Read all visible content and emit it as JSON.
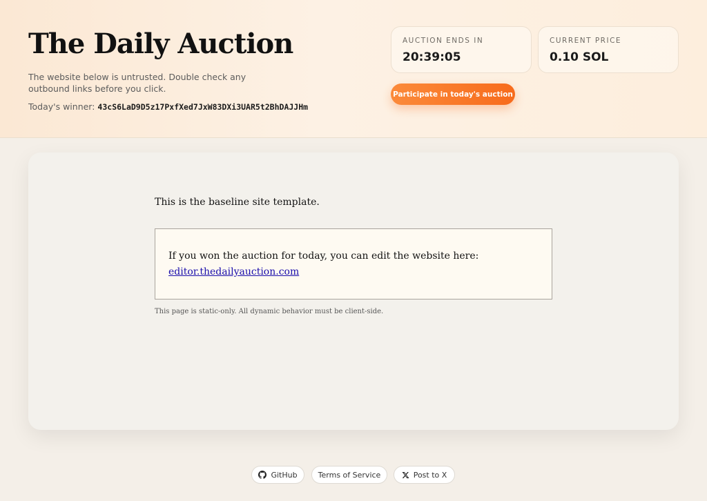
{
  "header": {
    "title": "The Daily Auction",
    "notice": "The website below is untrusted. Double check any outbound links before you click.",
    "winner_label": "Today's winner:",
    "winner_address": "43cS6LaD9D5z17PxfXed7JxW83DXi3UAR5t2BhDAJJHm"
  },
  "auction": {
    "ends_label": "AUCTION ENDS IN",
    "ends_value": "20:39:05",
    "price_label": "CURRENT PRICE",
    "price_value": "0.10 SOL",
    "cta_label": "Participate in today's auction"
  },
  "content": {
    "intro": "This is the baseline site template.",
    "edit_text": "If you won the auction for today, you can edit the website here:",
    "edit_link": "editor.thedailyauction.com",
    "footnote": "This page is static-only. All dynamic behavior must be client-side."
  },
  "footer": {
    "github_label": "GitHub",
    "tos_label": "Terms of Service",
    "post_label": "Post to X"
  },
  "icons": {
    "github": "github-icon",
    "x": "x-logo-icon"
  },
  "colors": {
    "accent": "#f76b1c",
    "link": "#1a0dab"
  }
}
